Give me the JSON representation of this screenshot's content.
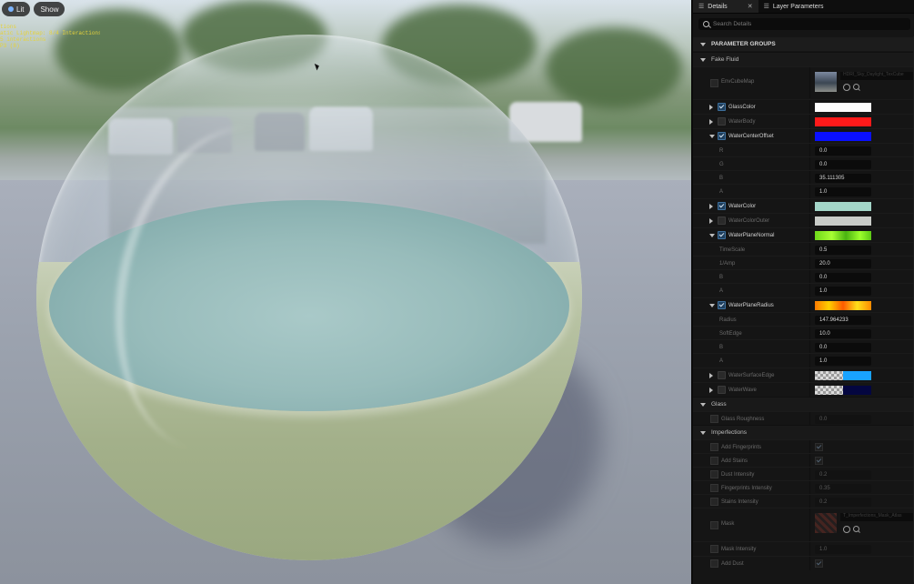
{
  "viewport": {
    "lit_label": "Lit",
    "show_label": "Show",
    "stats": [
      "tions",
      "atic Lightmap: 8/4 Interactions",
      "5 interactions",
      "",
      "P3  (8)"
    ]
  },
  "panel": {
    "tabs": [
      {
        "label": "Details",
        "active": true
      },
      {
        "label": "Layer Parameters",
        "active": false
      }
    ],
    "search_placeholder": "Search Details",
    "section_title": "PARAMETER GROUPS",
    "groups": {
      "fake_fluid": "Fake Fluid",
      "glass": "Glass",
      "imperfections": "Imperfections"
    },
    "rows": {
      "env_cube_map": {
        "label": "EnvCubeMap",
        "texture_name": "HDRI_Sky_Daylight_TexCube"
      },
      "glass_color": {
        "label": "GlassColor",
        "color": "#ffffff"
      },
      "water_body": {
        "label": "WaterBody",
        "color": "#ff1a1a"
      },
      "water_center_offset": {
        "label": "WaterCenterOffset",
        "color": "#0a10ff"
      },
      "wco_r": {
        "label": "R",
        "value": "0.0"
      },
      "wco_g": {
        "label": "G",
        "value": "0.0"
      },
      "wco_b": {
        "label": "B",
        "value": "35.111305"
      },
      "wco_a": {
        "label": "A",
        "value": "1.0"
      },
      "water_color": {
        "label": "WaterColor",
        "color": "#a3d6c8"
      },
      "water_color_outer": {
        "label": "WaterColorOuter",
        "color": "#c9ccc8"
      },
      "water_plane_normal": {
        "label": "WaterPlaneNormal"
      },
      "wpn_time_scale": {
        "label": "TimeScale",
        "value": "0.5"
      },
      "wpn_amp": {
        "label": "1/Amp",
        "value": "20.0"
      },
      "wpn_b": {
        "label": "B",
        "value": "0.0"
      },
      "wpn_a": {
        "label": "A",
        "value": "1.0"
      },
      "water_plane_radius": {
        "label": "WaterPlaneRadius"
      },
      "wpr_radius": {
        "label": "Radius",
        "value": "147.964233"
      },
      "wpr_soft_edge": {
        "label": "SoftEdge",
        "value": "10.0"
      },
      "wpr_b": {
        "label": "B",
        "value": "0.0"
      },
      "wpr_a": {
        "label": "A",
        "value": "1.0"
      },
      "water_surface_edge": {
        "label": "WaterSurfaceEdge"
      },
      "water_wave": {
        "label": "WaterWave"
      },
      "glass_roughness": {
        "label": "Glass Roughness",
        "value": "0.0"
      },
      "add_fingerprints": {
        "label": "Add Fingerprints"
      },
      "add_stains": {
        "label": "Add Stains"
      },
      "dust_intensity": {
        "label": "Dust Intensity",
        "value": "0.2"
      },
      "fingerprints_intensity": {
        "label": "Fingerprints Intensity",
        "value": "0.35"
      },
      "stains_intensity": {
        "label": "Stains Intensity",
        "value": "0.2"
      },
      "mask": {
        "label": "Mask",
        "texture_name": "T_Imperfections_Mask_Atlas"
      },
      "mask_intensity": {
        "label": "Mask Intensity",
        "value": "1.0"
      },
      "add_dust": {
        "label": "Add Dust"
      }
    }
  }
}
